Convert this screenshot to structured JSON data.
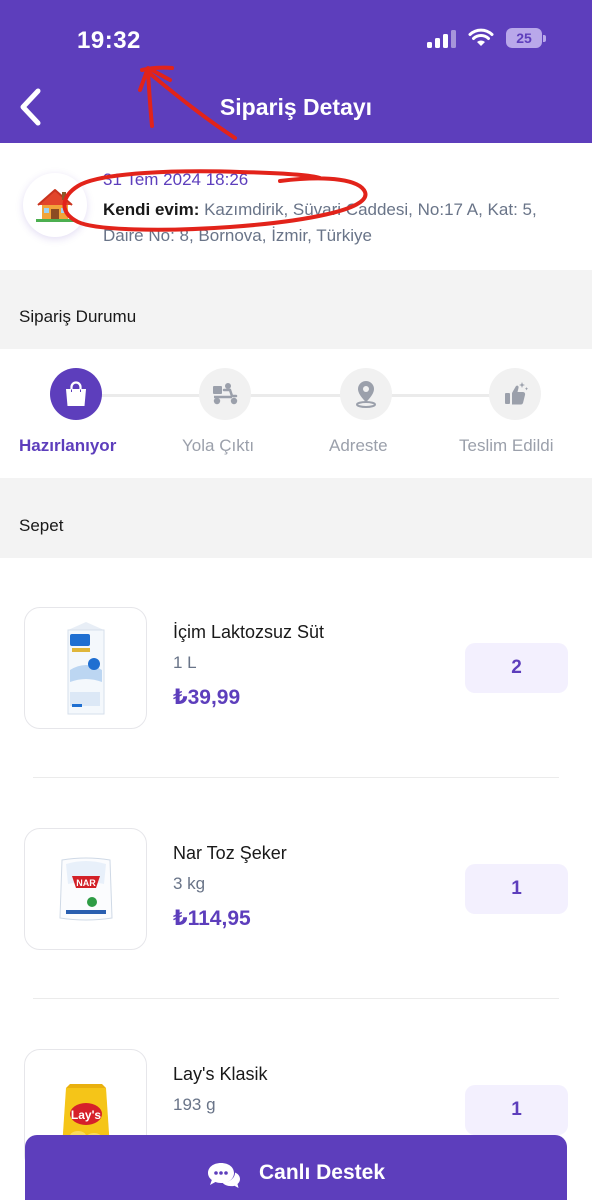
{
  "status_bar": {
    "time": "19:32",
    "battery": "25"
  },
  "header": {
    "title": "Sipariş Detayı"
  },
  "address": {
    "date": "31 Tem 2024 18:26",
    "label": "Kendi evim:",
    "detail": "Kazımdirik, Süvari Caddesi, No:17 A, Kat: 5, Daire No: 8, Bornova, İzmir, Türkiye"
  },
  "order_status": {
    "title": "Sipariş Durumu",
    "steps": [
      {
        "label": "Hazırlanıyor",
        "active": true,
        "icon": "shopping-bag-icon"
      },
      {
        "label": "Yola Çıktı",
        "active": false,
        "icon": "courier-scooter-icon"
      },
      {
        "label": "Adreste",
        "active": false,
        "icon": "location-pin-icon"
      },
      {
        "label": "Teslim Edildi",
        "active": false,
        "icon": "thumbs-up-icon"
      }
    ]
  },
  "cart": {
    "title": "Sepet",
    "items": [
      {
        "name": "İçim Laktozsuz Süt",
        "unit": "1 L",
        "price": "₺39,99",
        "quantity": "2",
        "image": "milk-carton-image"
      },
      {
        "name": "Nar Toz Şeker",
        "unit": "3 kg",
        "price": "₺114,95",
        "quantity": "1",
        "image": "sugar-bag-image"
      },
      {
        "name": "Lay's Klasik",
        "unit": "193 g",
        "price": "",
        "quantity": "1",
        "image": "chips-bag-image"
      }
    ]
  },
  "support_button": {
    "label": "Canlı Destek",
    "icon": "chat-bubbles-icon"
  },
  "colors": {
    "brand": "#5d3ebc",
    "annotation": "#e2231a"
  }
}
